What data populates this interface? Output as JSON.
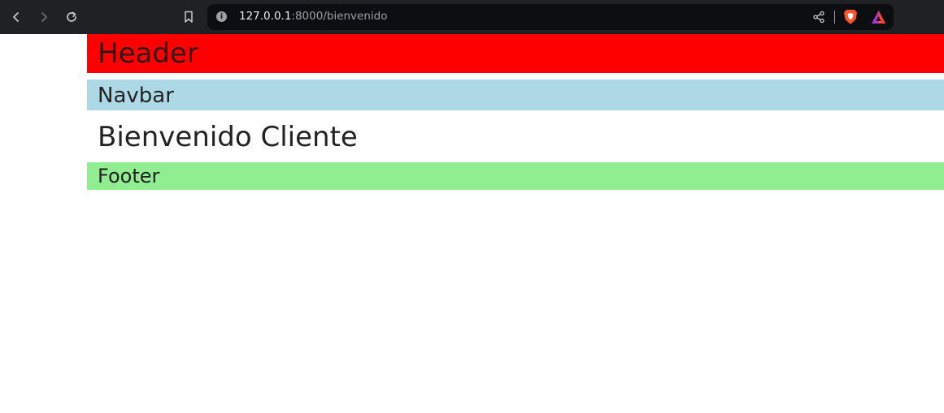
{
  "browser": {
    "url_host": "127.0.0.1",
    "url_rest": ":8000/bienvenido",
    "info_glyph": "i"
  },
  "page": {
    "header": "Header",
    "navbar": "Navbar",
    "welcome": "Bienvenido Cliente",
    "footer": "Footer"
  },
  "colors": {
    "header_bg": "#ff0000",
    "navbar_bg": "#add8e6",
    "footer_bg": "#90ee90",
    "toolbar_bg": "#202124",
    "urlbar_bg": "#0d0e11"
  }
}
